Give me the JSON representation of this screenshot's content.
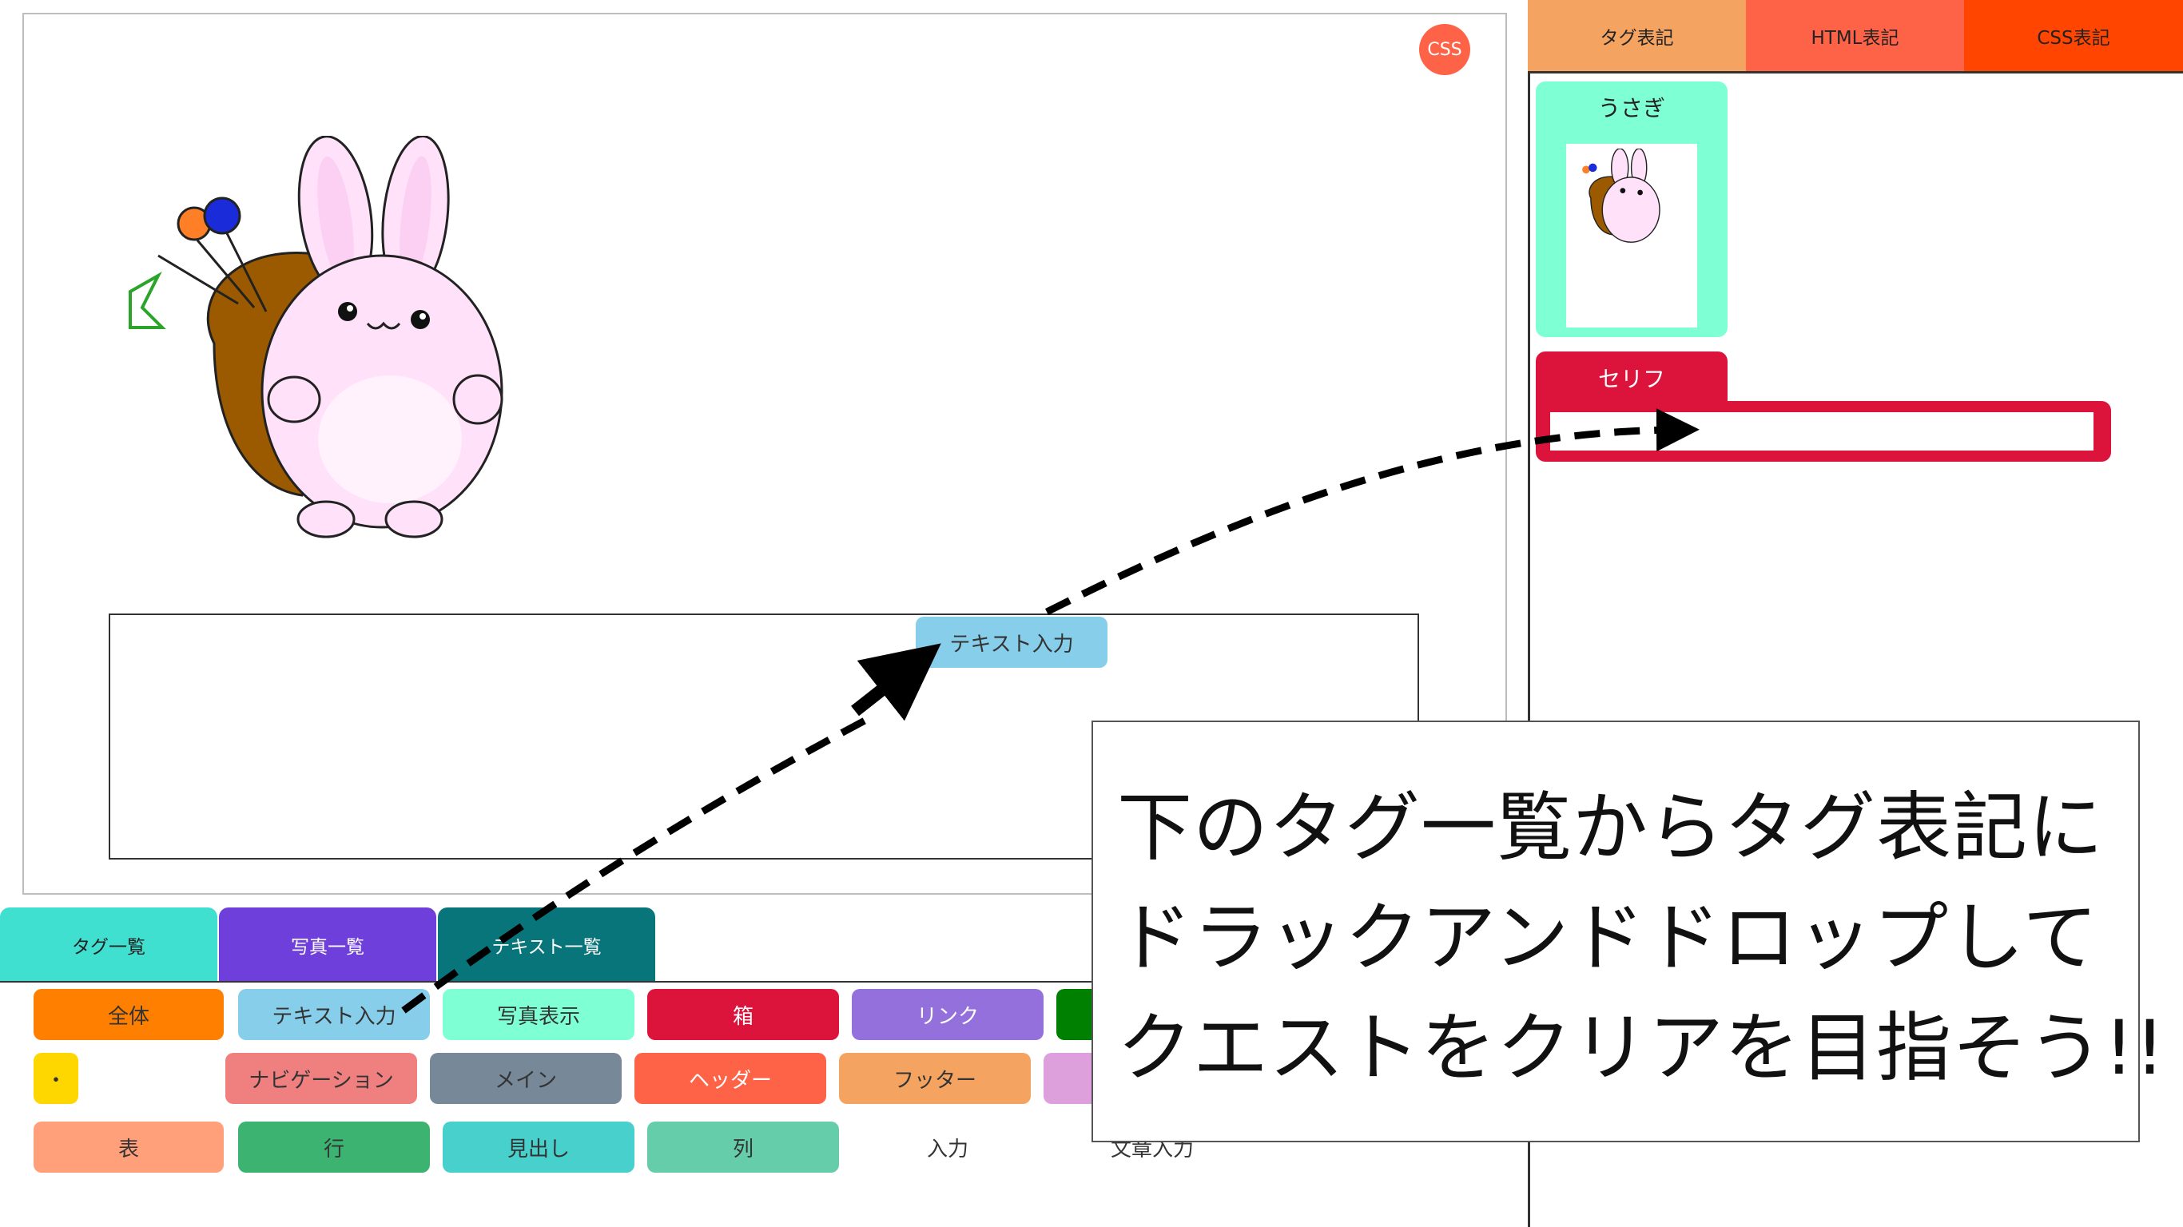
{
  "preview": {
    "css_badge": "CSS",
    "text_input_chip": "テキスト入力"
  },
  "right_panel": {
    "tabs": [
      "タグ表記",
      "HTML表記",
      "CSS表記"
    ],
    "tab_colors": [
      "#f4a460",
      "#ff6347",
      "#ff4500"
    ],
    "blocks": {
      "usagi_label": "うさぎ",
      "serif_label": "セリフ",
      "serif_value": ""
    }
  },
  "bottom_panel": {
    "tabs": [
      "タグ一覧",
      "写真一覧",
      "テキスト一覧"
    ],
    "tags": [
      {
        "label": "全体",
        "color": "#ff7f00"
      },
      {
        "label": "テキスト入力",
        "color": "#87ceeb"
      },
      {
        "label": "写真表示",
        "color": "#7fffd4"
      },
      {
        "label": "箱",
        "color": "#dc143c"
      },
      {
        "label": "リンク",
        "color": "#9370db"
      },
      {
        "label": "",
        "color": "#008000"
      },
      {
        "label": "・",
        "color": "#ffd700"
      },
      {
        "label": "ナビゲーション",
        "color": "#f08080"
      },
      {
        "label": "メイン",
        "color": "#778899"
      },
      {
        "label": "ヘッダー",
        "color": "#ff6347"
      },
      {
        "label": "フッター",
        "color": "#f4a460"
      },
      {
        "label": "",
        "color": "#dda0dd"
      },
      {
        "label": "表",
        "color": "#ffa07a"
      },
      {
        "label": "行",
        "color": "#3cb371"
      },
      {
        "label": "見出し",
        "color": "#48d1cc"
      },
      {
        "label": "列",
        "color": "#66cdaa"
      },
      {
        "label": "入力",
        "color": "#ffffff"
      },
      {
        "label": "文章入力",
        "color": "#ffffff"
      }
    ]
  },
  "callout": {
    "lines": [
      "下のタグ一覧からタグ表記に",
      "ドラックアンドドロップして",
      "クエストをクリアを目指そう!!"
    ]
  }
}
